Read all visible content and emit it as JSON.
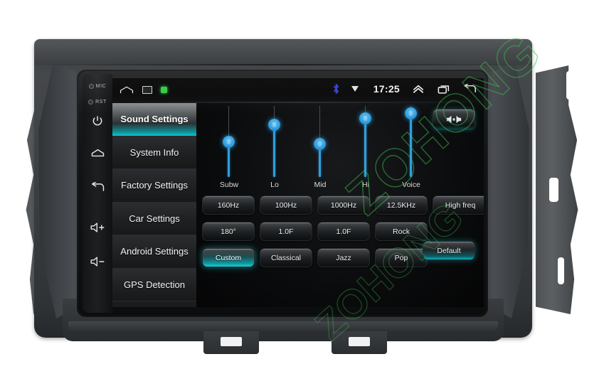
{
  "device": {
    "brand_watermark": "ZOHONG",
    "hardware_keys": [
      {
        "name": "mic",
        "label": "MIC",
        "type": "indicator"
      },
      {
        "name": "reset",
        "label": "RST",
        "type": "indicator"
      },
      {
        "name": "power",
        "label": "power-icon",
        "type": "button"
      },
      {
        "name": "home",
        "label": "home-icon",
        "type": "button"
      },
      {
        "name": "back",
        "label": "back-icon",
        "type": "button"
      },
      {
        "name": "volume-up",
        "label": "volume-up-icon",
        "type": "button"
      },
      {
        "name": "volume-down",
        "label": "volume-down-icon",
        "type": "button"
      }
    ]
  },
  "statusbar": {
    "home_icon": "home-icon",
    "gallery_icon": "gallery-icon",
    "status_dot": "green-status-dot",
    "bluetooth_icon": "bluetooth-icon",
    "dropdown_icon": "triangle-down-icon",
    "time": "17:25",
    "expand_icon": "chevron-up-icon",
    "recents_icon": "recent-apps-icon",
    "back_icon": "back-arrow-icon"
  },
  "sidebar": {
    "items": [
      {
        "label": "Sound Settings",
        "active": true
      },
      {
        "label": "System Info",
        "active": false
      },
      {
        "label": "Factory Settings",
        "active": false
      },
      {
        "label": "Car Settings",
        "active": false
      },
      {
        "label": "Android Settings",
        "active": false
      },
      {
        "label": "GPS Detection",
        "active": false
      }
    ]
  },
  "equalizer": {
    "balance_button": {
      "name": "balance-fader-button",
      "icon": "balance-speakers-icon"
    },
    "sliders": [
      {
        "label": "Subw",
        "value": 50
      },
      {
        "label": "Lo",
        "value": 76
      },
      {
        "label": "Mid",
        "value": 47
      },
      {
        "label": "Hi",
        "value": 86
      },
      {
        "label": "Voice",
        "value": 94
      }
    ]
  },
  "controls": {
    "row1": [
      {
        "label": "160Hz",
        "state": "normal"
      },
      {
        "label": "100Hz",
        "state": "normal"
      },
      {
        "label": "1000Hz",
        "state": "normal"
      },
      {
        "label": "12.5KHz",
        "state": "normal"
      },
      {
        "label": "High freq",
        "state": "normal"
      }
    ],
    "row2": [
      {
        "label": "180°",
        "state": "normal"
      },
      {
        "label": "1.0F",
        "state": "normal"
      },
      {
        "label": "1.0F",
        "state": "normal"
      },
      {
        "label": "Rock",
        "state": "normal"
      }
    ],
    "row3": [
      {
        "label": "Custom",
        "state": "selected"
      },
      {
        "label": "Classical",
        "state": "normal"
      },
      {
        "label": "Jazz",
        "state": "normal"
      },
      {
        "label": "Pop",
        "state": "normal"
      }
    ],
    "default_button": {
      "label": "Default",
      "state": "glow"
    }
  },
  "colors": {
    "accent_teal": "#13c3cb",
    "slider_blue": "#2f9fe0",
    "status_green": "#2ecc40",
    "bluetooth_blue": "#2244cc",
    "watermark_green": "#3cbe50",
    "screen_bg": "#050506",
    "sidebar_bg": "#1a1c1e"
  }
}
